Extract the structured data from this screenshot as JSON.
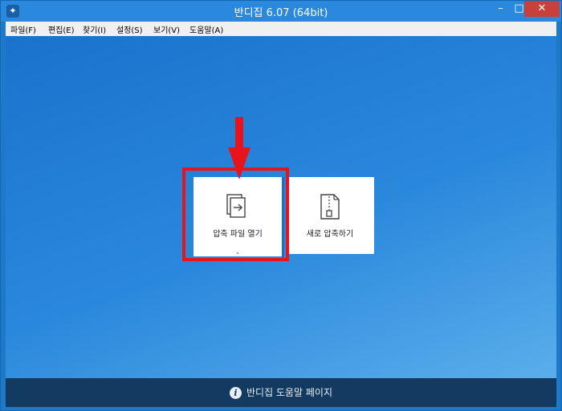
{
  "window": {
    "title": "반디집 6.07 (64bit)",
    "minimize_glyph": "–",
    "maximize_glyph": "□",
    "close_glyph": "✕"
  },
  "menu": {
    "items": [
      {
        "label": "파일(F)"
      },
      {
        "label": "편집(E)"
      },
      {
        "label": "찾기(I)"
      },
      {
        "label": "설정(S)"
      },
      {
        "label": "보기(V)"
      },
      {
        "label": "도움말(A)"
      }
    ]
  },
  "tiles": {
    "open": {
      "label": "압축 파일 열기",
      "icon": "open-archive-icon"
    },
    "new": {
      "label": "새로 압축하기",
      "icon": "zip-file-icon"
    }
  },
  "annotation": {
    "color": "#e8141b"
  },
  "footer": {
    "help_label": "반디집 도움말 페이지",
    "icon": "info-icon"
  },
  "colors": {
    "background": "#1e79c9",
    "footer": "#133a60",
    "close_button": "#c7403a"
  }
}
